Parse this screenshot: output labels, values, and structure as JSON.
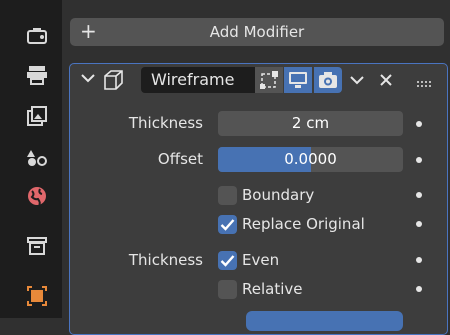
{
  "toolbar": {
    "add_modifier_label": "Add Modifier"
  },
  "modifier": {
    "name": "Wireframe",
    "show_in_editmode": false,
    "show_viewport": true,
    "show_render": true,
    "fields": {
      "thickness": {
        "label": "Thickness",
        "value": "2 cm"
      },
      "offset": {
        "label": "Offset",
        "value": "0.0000",
        "fill": 0.5
      }
    },
    "checkboxes": {
      "boundary": {
        "label": "Boundary",
        "checked": false
      },
      "replace_original": {
        "label": "Replace Original",
        "checked": true
      },
      "thickness_group_label": "Thickness",
      "even": {
        "label": "Even",
        "checked": true
      },
      "relative": {
        "label": "Relative",
        "checked": false
      }
    }
  },
  "colors": {
    "accent": "#4772b3",
    "panel_border": "#4a74c0",
    "object_tab": "#e8893a",
    "physics_tab": "#e0676b"
  }
}
